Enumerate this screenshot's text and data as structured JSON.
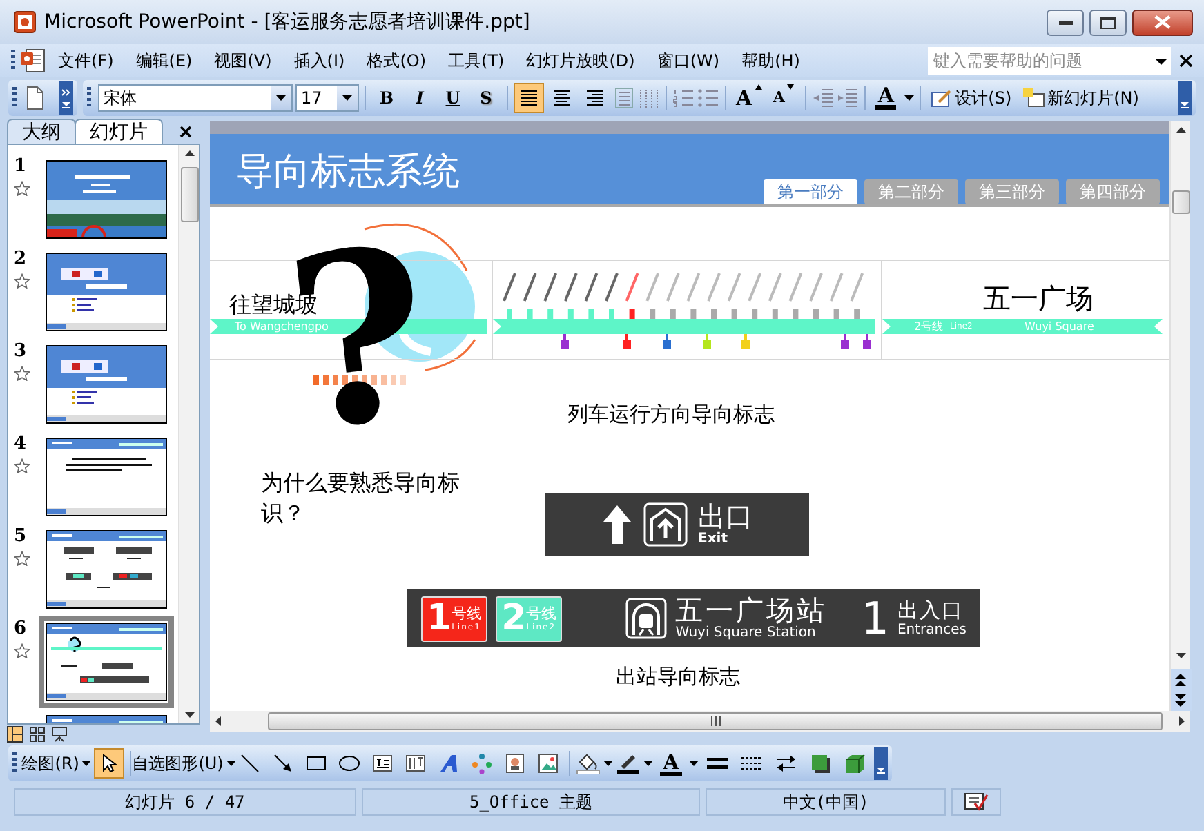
{
  "window": {
    "title": "Microsoft PowerPoint - [客运服务志愿者培训课件.ppt]"
  },
  "menu": [
    "文件(F)",
    "编辑(E)",
    "视图(V)",
    "插入(I)",
    "格式(O)",
    "工具(T)",
    "幻灯片放映(D)",
    "窗口(W)",
    "帮助(H)"
  ],
  "help_search": {
    "placeholder": "键入需要帮助的问题"
  },
  "format_toolbar": {
    "font": "宋体",
    "size": "17",
    "style_buttons": [
      "B",
      "I",
      "U",
      "S"
    ],
    "align_buttons": [
      {
        "selected": true
      },
      {
        "selected": false
      },
      {
        "selected": false
      }
    ],
    "font_size_buttons": [
      "A",
      "A"
    ],
    "font_color": "A",
    "design": "设计(S)",
    "new_slide": "新幻灯片(N)"
  },
  "side_pane": {
    "tabs": [
      {
        "label": "大纲",
        "selected": false
      },
      {
        "label": "幻灯片",
        "selected": true
      }
    ],
    "slides": [
      {
        "number": "1",
        "kind": "photo",
        "selected": false
      },
      {
        "number": "2",
        "kind": "banner-list",
        "selected": false
      },
      {
        "number": "3",
        "kind": "banner-list",
        "selected": false
      },
      {
        "number": "4",
        "kind": "header-text",
        "selected": false
      },
      {
        "number": "5",
        "kind": "header-signs",
        "selected": false
      },
      {
        "number": "6",
        "kind": "header-map",
        "selected": true
      },
      {
        "kind": "header",
        "selected": false
      }
    ]
  },
  "slide": {
    "title": "导向标志系统",
    "section_tabs": [
      {
        "label": "第一部分",
        "selected": true
      },
      {
        "label": "第二部分",
        "selected": false
      },
      {
        "label": "第三部分",
        "selected": false
      },
      {
        "label": "第四部分",
        "selected": false
      }
    ],
    "route_map": {
      "left_station": "往望城坡",
      "left_english": "To Wangchengpo",
      "right_station": "五一广场",
      "right_line": "2号线",
      "right_line_english": "Line2",
      "right_english": "Wuyi Square"
    },
    "question_mark": "?",
    "caption_1": "列车运行方向导向标志",
    "question": "为什么要熟悉导向标识？",
    "exit_sign": {
      "label": "出口",
      "english": "Exit"
    },
    "station_sign": {
      "lines": [
        {
          "number": "1",
          "label": "号线",
          "english": "Line1",
          "color": "#f5261a"
        },
        {
          "number": "2",
          "label": "号线",
          "english": "Line2",
          "color": "#5ee8c4"
        }
      ],
      "name": "五一广场站",
      "english": "Wuyi Square Station",
      "exit_number": "1",
      "exit_label": "出入口",
      "exit_english": "Entrances"
    },
    "caption_2": "出站导向标志"
  },
  "drawing_toolbar": {
    "draw": "绘图(R)",
    "select_tool": {
      "selected": true
    },
    "autoshapes": "自选图形(U)",
    "font_color": "A"
  },
  "status_bar": [
    "幻灯片 6 / 47",
    "5_Office 主题",
    "中文(中国)"
  ]
}
